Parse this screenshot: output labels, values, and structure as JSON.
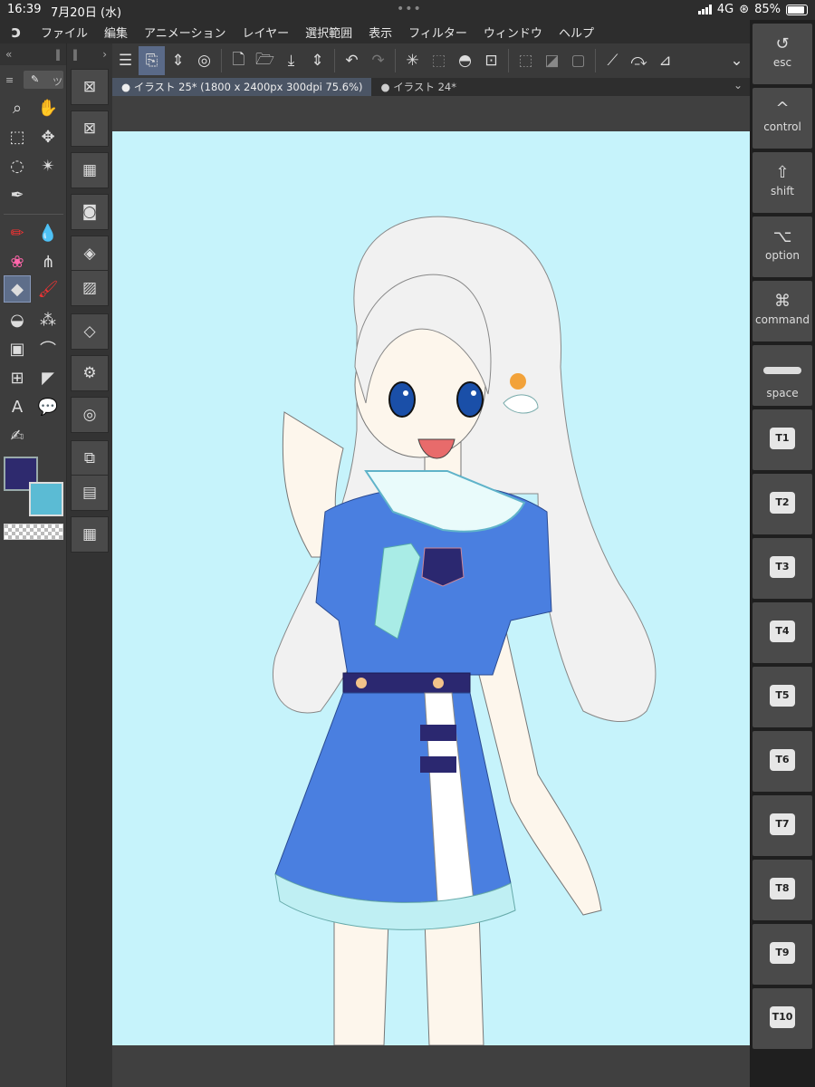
{
  "status": {
    "time": "16:39",
    "date": "7月20日 (水)",
    "network": "4G",
    "battery": "85%"
  },
  "menu": {
    "logo": "ↄ",
    "items": [
      "ファイル",
      "編集",
      "アニメーション",
      "レイヤー",
      "選択範囲",
      "表示",
      "フィルター",
      "ウィンドウ",
      "ヘルプ"
    ]
  },
  "tabs": {
    "active": "イラスト 25* (1800 x 2400px 300dpi 75.6%)",
    "inactive": "イラスト 24*",
    "dot": "●"
  },
  "keys": [
    {
      "sym": "↺",
      "label": "esc"
    },
    {
      "sym": "^",
      "label": "control"
    },
    {
      "sym": "⇧",
      "label": "shift"
    },
    {
      "sym": "⌥",
      "label": "option"
    },
    {
      "sym": "⌘",
      "label": "command"
    },
    {
      "sym": "",
      "label": "space"
    }
  ],
  "tkeys": [
    "T1",
    "T2",
    "T3",
    "T4",
    "T5",
    "T6",
    "T7",
    "T8",
    "T9",
    "T10"
  ],
  "colors": {
    "main": "#2e2a6e",
    "sub": "#5bbbd4",
    "canvas_bg": "#c6f3fb",
    "dress": "#4a7fe0"
  },
  "tool_tab_label": "ツ"
}
